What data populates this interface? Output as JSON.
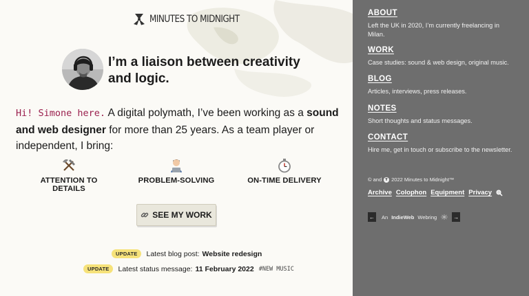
{
  "brand": {
    "name": "MINUTES TO MIDNIGHT",
    "logo_icon": "radiation-icon"
  },
  "hero": {
    "headline": "I’m a liaison between creativity and logic."
  },
  "intro": {
    "greeting": "Hi! Simone here.",
    "text_1": " A digital polymath, I’ve been working as a ",
    "bold_1": "sound and web designer",
    "text_2": " for more than 25 years. As a team player or inde­pendent, I bring:"
  },
  "skills": [
    {
      "icon": "hammer-pick-icon",
      "label": "ATTENTION TO DETAILS"
    },
    {
      "icon": "technologist-icon",
      "label": "PROBLEM-SOLVING"
    },
    {
      "icon": "stopwatch-icon",
      "label": "ON-TIME DELIVERY"
    }
  ],
  "cta": {
    "icon": "link-icon",
    "label": "SEE MY WORK"
  },
  "updates": [
    {
      "badge": "UPDATE",
      "text": "Latest blog post:",
      "link": "Website redesign",
      "tag": ""
    },
    {
      "badge": "UPDATE",
      "text": "Latest status message:",
      "link": "11 February 2022",
      "tag": "#NEW MUSIC"
    }
  ],
  "sidebar": {
    "sections": [
      {
        "title": "ABOUT",
        "text": "Left the UK in 2020, I’m currently freelancing in Milan."
      },
      {
        "title": "WORK",
        "text": "Case studies: sound & web design, original music."
      },
      {
        "title": "BLOG",
        "text": "Articles, interviews, press releases."
      },
      {
        "title": "NOTES",
        "text": "Short thoughts and status messages."
      },
      {
        "title": "CONTACT",
        "text": "Hire me, get in touch or subscribe to the newsletter."
      }
    ],
    "copyright_prefix": "© and",
    "copyright": "2022 Minutes to Midnight™",
    "footer_links": [
      "Archive",
      "Colophon",
      "Equipment",
      "Privacy"
    ],
    "webring": {
      "prev": "←",
      "prefix": "An",
      "name": "IndieWeb",
      "suffix": "Webring",
      "next": "→"
    }
  },
  "colors": {
    "sidebar_bg": "#6e6e6e",
    "greeting": "#9a1f4d",
    "badge": "#f6e27a",
    "button_bg": "#e9e7dc"
  }
}
